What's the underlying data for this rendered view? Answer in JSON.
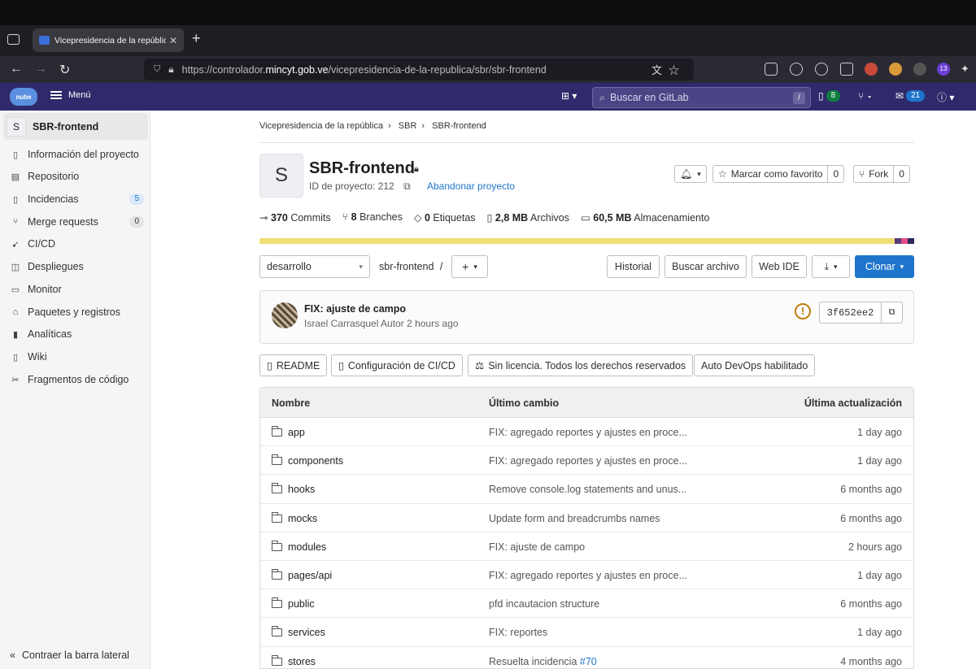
{
  "browser": {
    "tab_title": "Vicepresidencia de la república",
    "url_prefix": "https://controlador.",
    "url_host": "mincyt.gob.ve",
    "url_path": "/vicepresidencia-de-la-republica/sbr/sbr-frontend",
    "ext_badge": "13"
  },
  "gitlab_bar": {
    "logo_text": "nube",
    "menu_label": "Menú",
    "search_placeholder": "Buscar en GitLab",
    "search_shortcut": "/",
    "issues_count": "8",
    "todos_count": "21"
  },
  "sidebar": {
    "project_initial": "S",
    "project_name": "SBR-frontend",
    "items": [
      {
        "label": "Información del proyecto",
        "icon": "info-icon"
      },
      {
        "label": "Repositorio",
        "icon": "document-icon"
      },
      {
        "label": "Incidencias",
        "icon": "issues-icon",
        "count": "5"
      },
      {
        "label": "Merge requests",
        "icon": "merge-icon",
        "count": "0"
      },
      {
        "label": "CI/CD",
        "icon": "rocket-icon"
      },
      {
        "label": "Despliegues",
        "icon": "deploy-icon"
      },
      {
        "label": "Monitor",
        "icon": "monitor-icon"
      },
      {
        "label": "Paquetes y registros",
        "icon": "package-icon"
      },
      {
        "label": "Analíticas",
        "icon": "chart-icon"
      },
      {
        "label": "Wiki",
        "icon": "book-icon"
      },
      {
        "label": "Fragmentos de código",
        "icon": "snippet-icon"
      }
    ],
    "collapse_label": "Contraer la barra lateral"
  },
  "breadcrumb": [
    "Vicepresidencia de la república",
    "SBR",
    "SBR-frontend"
  ],
  "project": {
    "initial": "S",
    "title": "SBR-frontend",
    "id_label": "ID de proyecto: 212",
    "leave_label": "Abandonar proyecto",
    "star_label": "Marcar como favorito",
    "star_count": "0",
    "fork_label": "Fork",
    "fork_count": "0"
  },
  "stats": [
    {
      "value": "370",
      "label": "Commits",
      "icon": "commit-icon"
    },
    {
      "value": "8",
      "label": "Branches",
      "icon": "branch-icon"
    },
    {
      "value": "0",
      "label": "Etiquetas",
      "icon": "tag-icon"
    },
    {
      "value": "2,8 MB",
      "label": "Archivos",
      "icon": "file-icon"
    },
    {
      "value": "60,5 MB",
      "label": "Almacenamiento",
      "icon": "storage-icon"
    }
  ],
  "colors": {
    "lang_main": "#f0dd74",
    "lang_a": "#563d7c",
    "lang_b": "#e34c8a",
    "lang_c": "#2b2b5c",
    "nav": "#2f2a6b",
    "accent": "#1f75cb"
  },
  "repo_toolbar": {
    "branch": "desarrollo",
    "path": "sbr-frontend",
    "path_sep": "/",
    "history": "Historial",
    "find_file": "Buscar archivo",
    "web_ide": "Web IDE",
    "clone": "Clonar"
  },
  "last_commit": {
    "message": "FIX: ajuste de campo",
    "author_line": "Israel Carrasquel Autor 2 hours ago",
    "sha": "3f652ee2",
    "status": "!"
  },
  "chips": [
    {
      "label": "README",
      "icon": "readme-icon"
    },
    {
      "label": "Configuración de CI/CD",
      "icon": "file-icon"
    },
    {
      "label": "Sin licencia. Todos los derechos reservados",
      "icon": "scale-icon"
    },
    {
      "label": "Auto DevOps habilitado",
      "icon": ""
    }
  ],
  "file_table": {
    "headers": [
      "Nombre",
      "Último cambio",
      "Última actualización"
    ],
    "rows": [
      {
        "name": "app",
        "message": "FIX: agregado reportes y ajustes en proce...",
        "date": "1 day ago"
      },
      {
        "name": "components",
        "message": "FIX: agregado reportes y ajustes en proce...",
        "date": "1 day ago"
      },
      {
        "name": "hooks",
        "message": "Remove console.log statements and unus...",
        "date": "6 months ago"
      },
      {
        "name": "mocks",
        "message": "Update form and breadcrumbs names",
        "date": "6 months ago"
      },
      {
        "name": "modules",
        "message": "FIX: ajuste de campo",
        "date": "2 hours ago"
      },
      {
        "name": "pages/api",
        "message": "FIX: agregado reportes y ajustes en proce...",
        "date": "1 day ago"
      },
      {
        "name": "public",
        "message": "pfd incautacion structure",
        "date": "6 months ago"
      },
      {
        "name": "services",
        "message": "FIX: reportes",
        "date": "1 day ago"
      },
      {
        "name": "stores",
        "message": "Resuelta incidencia ",
        "link": "#70",
        "date": "4 months ago"
      }
    ]
  }
}
